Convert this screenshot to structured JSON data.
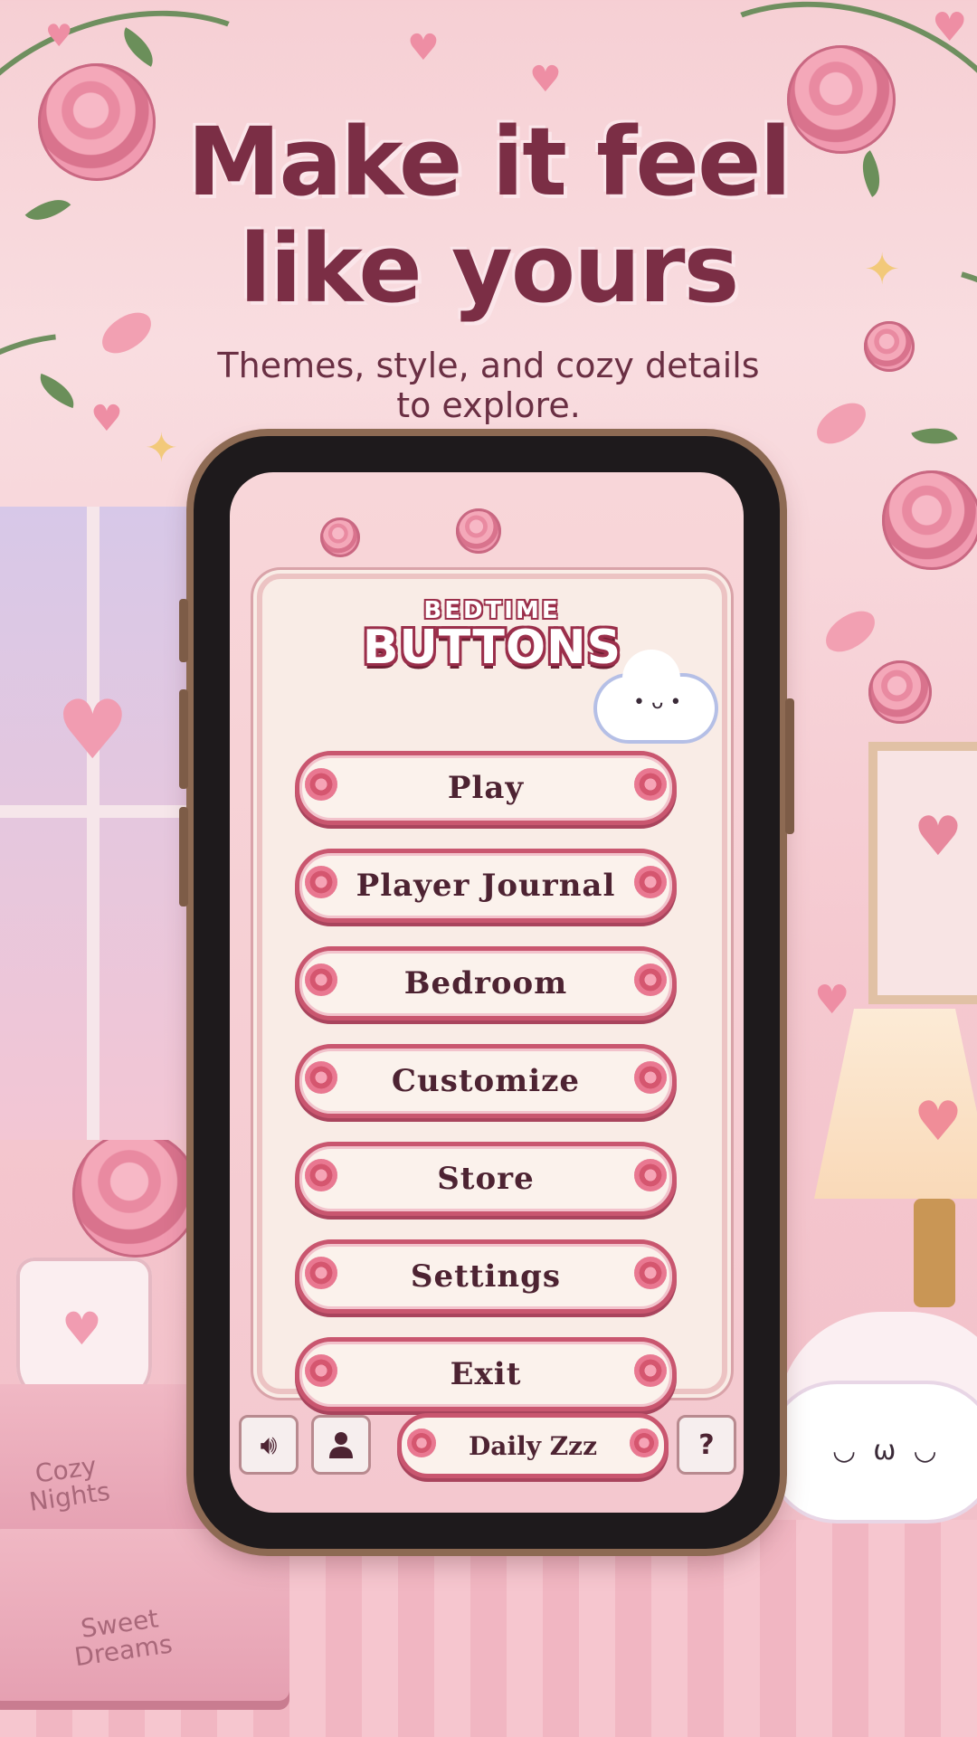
{
  "headline": {
    "line1": "Make it feel",
    "line2": "like yours",
    "subtitle_line1": "Themes, style, and cozy details",
    "subtitle_line2": "to explore."
  },
  "game": {
    "logo_small": "BEDTIME",
    "logo_big": "BUTTONS",
    "menu": [
      {
        "label": "Play"
      },
      {
        "label": "Player Journal"
      },
      {
        "label": "Bedroom"
      },
      {
        "label": "Customize"
      },
      {
        "label": "Store"
      },
      {
        "label": "Settings"
      },
      {
        "label": "Exit"
      }
    ],
    "bottom_bar": {
      "sound_icon": "speaker-icon",
      "profile_icon": "person-icon",
      "daily_label": "Daily Zzz",
      "help_label": "?"
    }
  },
  "scene": {
    "book1_title": "Cozy\nNights",
    "book2_title": "Sweet\nDreams"
  },
  "colors": {
    "accent": "#c9566f",
    "headline": "#7b2e45",
    "button_fill": "#fbf2ec",
    "background": "#f6cfd4"
  }
}
